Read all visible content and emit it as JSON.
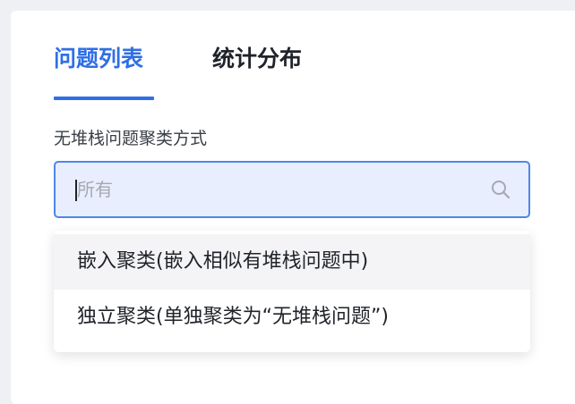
{
  "tabs": [
    {
      "label": "问题列表",
      "active": true
    },
    {
      "label": "统计分布",
      "active": false
    }
  ],
  "filter": {
    "label": "无堆栈问题聚类方式",
    "placeholder": "所有",
    "value": ""
  },
  "dropdown": {
    "options": [
      {
        "label": "嵌入聚类(嵌入相似有堆栈问题中)",
        "highlighted": true
      },
      {
        "label": "独立聚类(单独聚类为“无堆栈问题”)",
        "highlighted": false
      }
    ]
  },
  "icons": {
    "search": "search-icon"
  },
  "colors": {
    "accent": "#2f6fe4",
    "input_bg": "#e8eefd",
    "input_border": "#4f86ea",
    "hover_bg": "#f4f4f6"
  }
}
